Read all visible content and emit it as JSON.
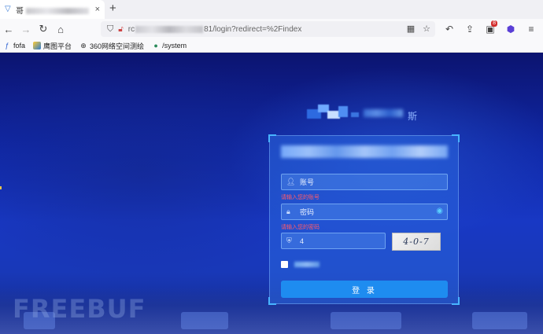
{
  "browser": {
    "tab": {
      "title": "哥",
      "close_glyph": "×"
    },
    "new_tab_glyph": "+",
    "nav": {
      "back": "←",
      "forward": "→",
      "reload": "↻",
      "home": "⌂"
    },
    "address": {
      "host_visible": "rc",
      "path_visible": "81/login?redirect=%2Findex"
    },
    "toolbar_right": {
      "badge_count": "8"
    }
  },
  "bookmarks": [
    {
      "label": "fofa",
      "icon": "fofa-icon"
    },
    {
      "label": "鹰图平台",
      "icon": "hunter-icon"
    },
    {
      "label": "360网络空间测绘",
      "icon": "globe-icon"
    },
    {
      "label": "/system",
      "icon": "leaf-icon"
    }
  ],
  "page": {
    "logo_char": "斯",
    "login": {
      "username_placeholder": "账号",
      "username_error": "请输入您的账号",
      "password_placeholder": "密码",
      "password_error": "请输入您的密码",
      "captcha_value": "4",
      "captcha_image_text": "4-0-7",
      "submit_label": "登 录"
    },
    "watermark": "FREEBUF"
  },
  "colors": {
    "accent": "#1e8cf0",
    "error": "#ff5a6a",
    "background_top": "#0c1470",
    "background_mid": "#1838c4"
  }
}
